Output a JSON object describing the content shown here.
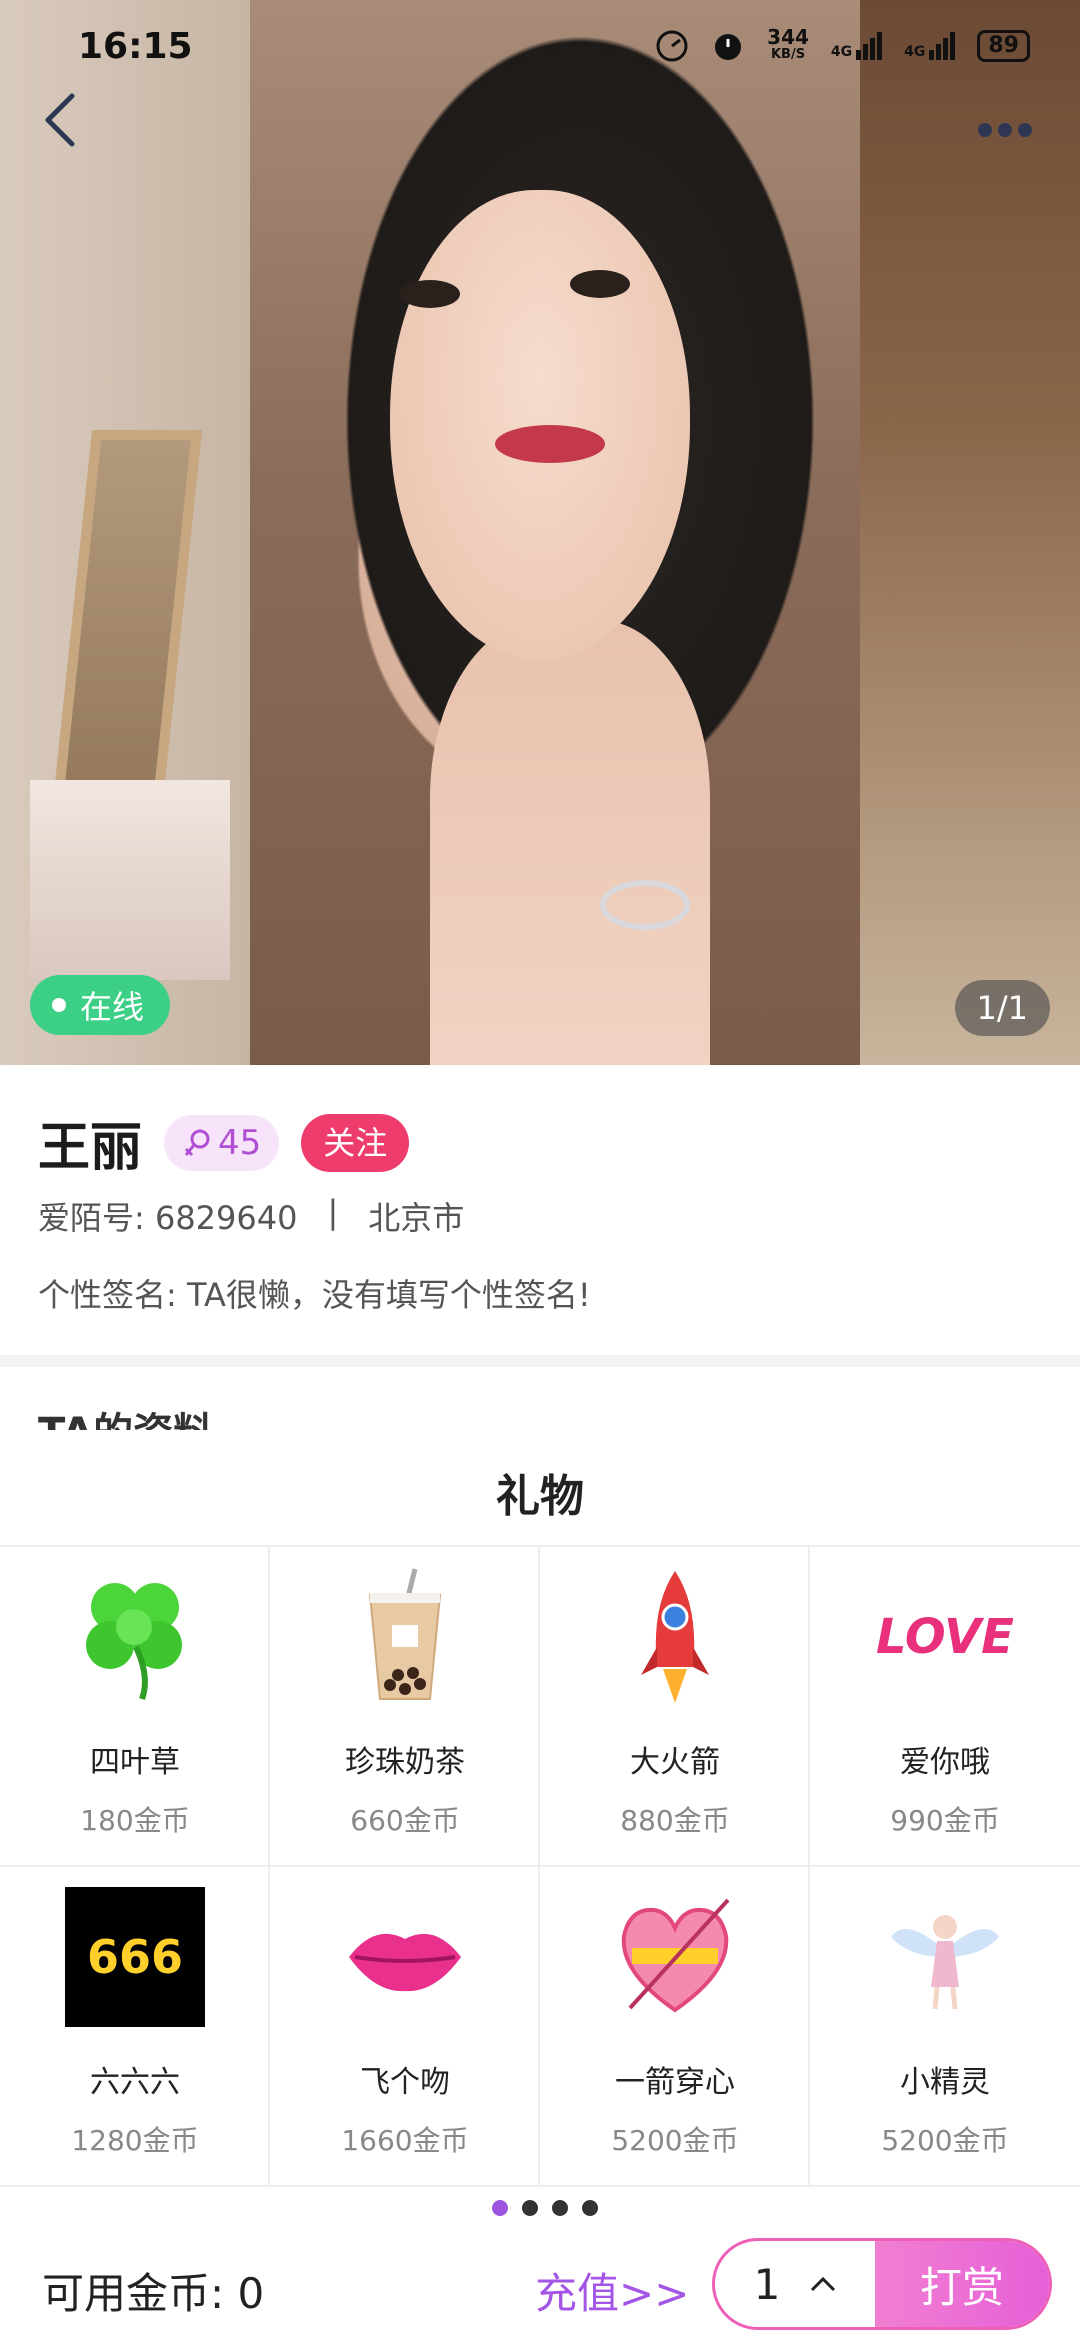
{
  "status_bar": {
    "time": "16:15",
    "net_speed_value": "344",
    "net_speed_unit": "KB/S",
    "signal1": "4G",
    "signal2": "4G",
    "battery": "89"
  },
  "header": {
    "back_icon": "chevron-left-icon",
    "more_icon": "more-dots-icon"
  },
  "photo": {
    "online_label": "在线",
    "counter": "1/1"
  },
  "profile": {
    "name": "王丽",
    "level": "45",
    "follow_label": "关注",
    "id_label": "爱陌号: 6829640",
    "separator": "|",
    "city": "北京市",
    "signature": "个性签名: TA很懒，没有填写个性签名!"
  },
  "section_peek": "TA的资料",
  "gift_sheet": {
    "title": "礼物",
    "gifts": [
      {
        "name": "四叶草",
        "price": "180金币",
        "icon": "clover-icon"
      },
      {
        "name": "珍珠奶茶",
        "price": "660金币",
        "icon": "bubble-tea-icon"
      },
      {
        "name": "大火箭",
        "price": "880金币",
        "icon": "rocket-icon"
      },
      {
        "name": "爱你哦",
        "price": "990金币",
        "icon": "love-text-icon",
        "icon_text": "LOVE"
      },
      {
        "name": "六六六",
        "price": "1280金币",
        "icon": "666-icon",
        "icon_text": "666"
      },
      {
        "name": "飞个吻",
        "price": "1660金币",
        "icon": "lips-icon"
      },
      {
        "name": "一箭穿心",
        "price": "5200金币",
        "icon": "arrow-heart-icon"
      },
      {
        "name": "小精灵",
        "price": "5200金币",
        "icon": "fairy-icon"
      }
    ],
    "pager": {
      "pages": 4,
      "active": 0
    },
    "coins_label": "可用金币: 0",
    "recharge_label": "充值>>",
    "quantity": "1",
    "send_label": "打赏"
  },
  "colors": {
    "accent_purple": "#a355e6",
    "follow_pink": "#ee3c6d",
    "online_green": "#3ccf86"
  }
}
